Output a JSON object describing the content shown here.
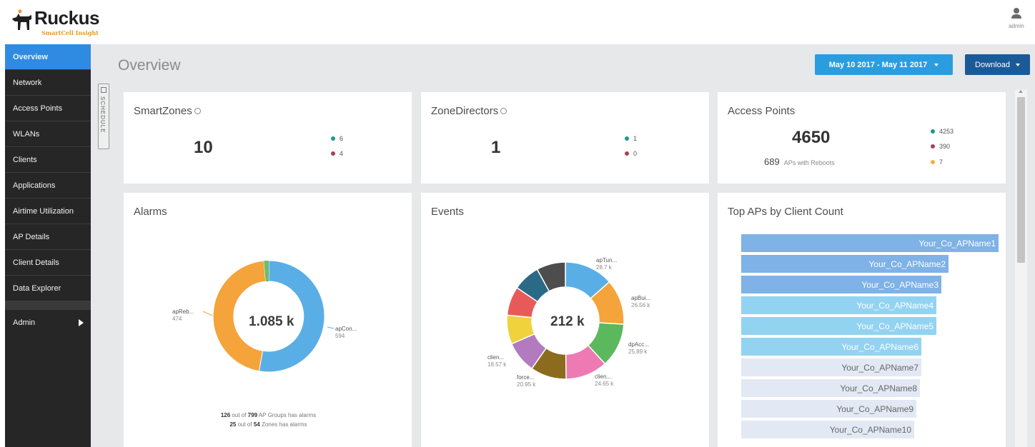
{
  "app": {
    "brand": "Ruckus",
    "subtitle": "SmartCell Insight",
    "user": "admin"
  },
  "sidebar": {
    "items": [
      {
        "label": "Overview",
        "active": true
      },
      {
        "label": "Network"
      },
      {
        "label": "Access Points"
      },
      {
        "label": "WLANs"
      },
      {
        "label": "Clients"
      },
      {
        "label": "Applications"
      },
      {
        "label": "Airtime Utilization"
      },
      {
        "label": "AP Details"
      },
      {
        "label": "Client Details"
      },
      {
        "label": "Data Explorer"
      }
    ],
    "admin_label": "Admin"
  },
  "header": {
    "title": "Overview",
    "date_range": "May 10 2017 - May 11 2017",
    "download_label": "Download",
    "schedule_label": "SCHEDULE"
  },
  "cards": {
    "smartzones": {
      "title": "SmartZones",
      "total": "10",
      "legend": [
        {
          "value": "6",
          "color": "#1a9a8c"
        },
        {
          "value": "4",
          "color": "#a8404f"
        }
      ]
    },
    "zonedirectors": {
      "title": "ZoneDirectors",
      "total": "1",
      "legend": [
        {
          "value": "1",
          "color": "#1a9a8c"
        },
        {
          "value": "0",
          "color": "#a8404f"
        }
      ]
    },
    "access_points": {
      "title": "Access Points",
      "total": "4650",
      "reboots_count": "689",
      "reboots_label": "APs with Reboots",
      "legend": [
        {
          "value": "4253",
          "color": "#1a9a8c"
        },
        {
          "value": "390",
          "color": "#a8404f"
        },
        {
          "value": "7",
          "color": "#f2b233"
        }
      ]
    },
    "alarms": {
      "title": "Alarms",
      "center": "1.085 k",
      "left_label": "apReb...",
      "left_value": "474",
      "right_label": "apCon...",
      "right_value": "594",
      "footer_1_a": "126",
      "footer_1_b": "out of",
      "footer_1_c": "799",
      "footer_1_d": "AP Groups has alarms",
      "footer_2_a": "25",
      "footer_2_b": "out of",
      "footer_2_c": "54",
      "footer_2_d": "Zones has alarms"
    },
    "events": {
      "title": "Events",
      "center": "212 k",
      "callouts": [
        {
          "label": "apTun...",
          "value": "28.7 k"
        },
        {
          "label": "apBui...",
          "value": "26.56 k"
        },
        {
          "label": "dpAcc...",
          "value": "25.89 k"
        },
        {
          "label": "clien...",
          "value": "24.65 k"
        },
        {
          "label": "force...",
          "value": "20.95 k"
        },
        {
          "label": "clien...",
          "value": "18.57 k"
        }
      ]
    },
    "top_aps": {
      "title": "Top APs by Client Count",
      "bars": [
        "Your_Co_APName1",
        "Your_Co_APName2",
        "Your_Co_APName3",
        "Your_Co_APName4",
        "Your_Co_APName5",
        "Your_Co_APName6",
        "Your_Co_APName7",
        "Your_Co_APName8",
        "Your_Co_APName9",
        "Your_Co_APName10"
      ]
    }
  },
  "colors": {
    "accent": "#2a9de0",
    "download": "#1b5a98",
    "sidebar": "#262626",
    "active": "#2f8be2",
    "alarm_blue": "#5aaee6",
    "alarm_orange": "#f4a43a",
    "alarm_green": "#6cbd6a"
  }
}
